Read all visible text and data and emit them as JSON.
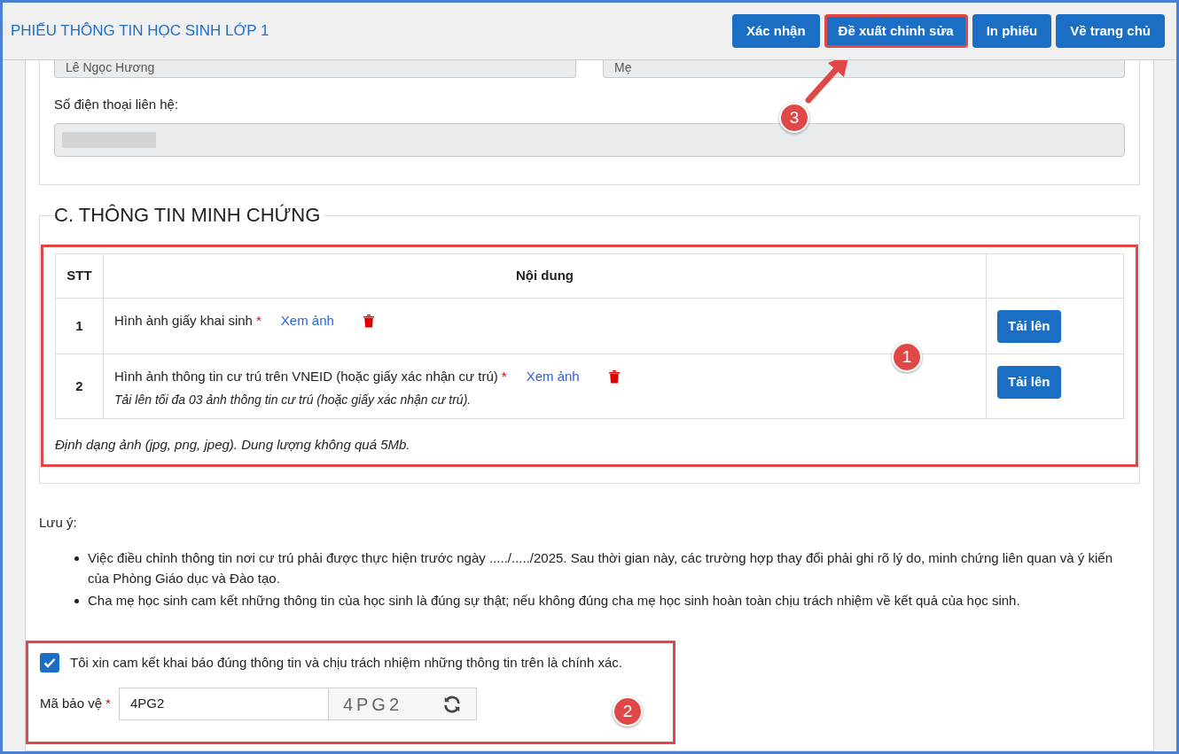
{
  "header": {
    "title": "PHIẾU THÔNG TIN HỌC SINH LỚP 1",
    "buttons": [
      {
        "label": "Xác nhận",
        "highlighted": false
      },
      {
        "label": "Đề xuất chỉnh sửa",
        "highlighted": true
      },
      {
        "label": "In phiếu",
        "highlighted": false
      },
      {
        "label": "Về trang chủ",
        "highlighted": false
      }
    ]
  },
  "contact": {
    "fields": [
      {
        "value": "Lê Ngọc Hương"
      },
      {
        "value": "Mẹ"
      }
    ],
    "phone_label": "Số điện thoại liên hệ:"
  },
  "evidence": {
    "title": "C. THÔNG TIN MINH CHỨNG",
    "columns": [
      "STT",
      "Nội dung"
    ],
    "rows": [
      {
        "stt": "1",
        "label": "Hình ảnh giấy khai sinh",
        "required_mark": "*",
        "view_link": "Xem ảnh",
        "upload": "Tải lên"
      },
      {
        "stt": "2",
        "label": "Hình ảnh thông tin cư trú trên VNEID (hoặc giấy xác nhận cư trú)",
        "required_mark": "*",
        "view_link": "Xem ảnh",
        "note": "Tải lên tối đa 03 ảnh thông tin cư trú (hoặc giấy xác nhận cư trú).",
        "upload": "Tải lên"
      }
    ],
    "footnote": "Định dạng ảnh (jpg, png, jpeg). Dung lượng không quá 5Mb."
  },
  "notes": {
    "title": "Lưu ý:",
    "items": [
      "Việc điều chỉnh thông tin nơi cư trú phải được thực hiện trước ngày ...../...../2025. Sau thời gian này, các trường hợp thay đổi phải ghi rõ lý do, minh chứng liên quan và ý kiến của Phòng Giáo dục và Đào tạo.",
      "Cha mẹ học sinh cam kết những thông tin của học sinh là đúng sự thật; nếu không đúng cha mẹ học sinh hoàn toàn chịu trách nhiệm về kết quả của học sinh."
    ]
  },
  "commitment": {
    "checked": true,
    "text": "Tôi xin cam kết khai báo đúng thông tin và chịu trách nhiệm những thông tin trên là chính xác."
  },
  "captcha": {
    "label": "Mã bảo vệ",
    "required_mark": "*",
    "value": "4PG2",
    "image_text": "4PG2"
  },
  "annotations": [
    {
      "number": "1"
    },
    {
      "number": "2"
    },
    {
      "number": "3"
    }
  ]
}
